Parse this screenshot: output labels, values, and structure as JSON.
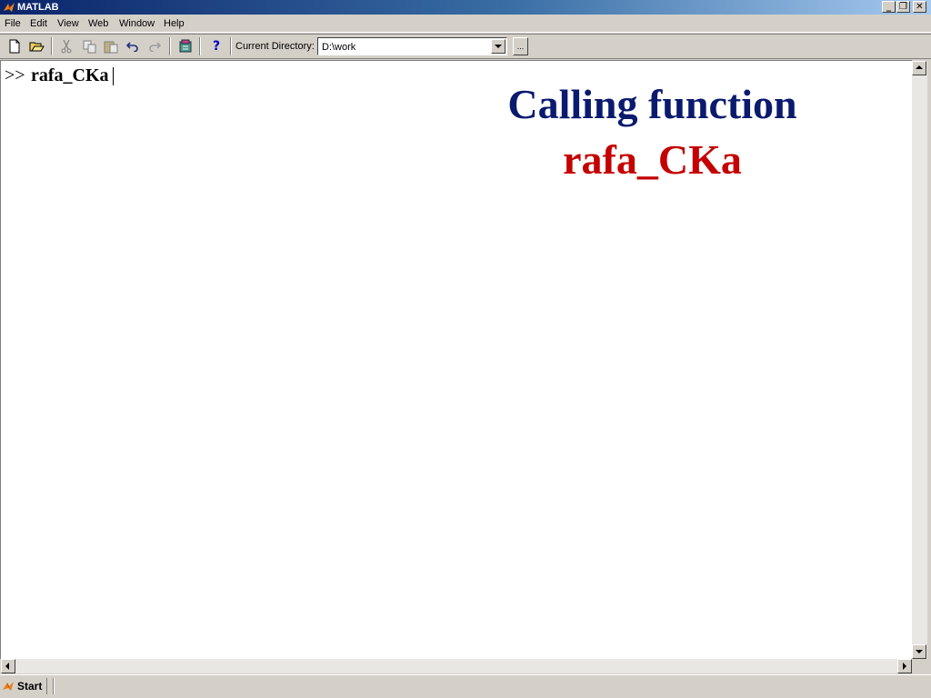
{
  "window": {
    "title": "MATLAB",
    "controls": {
      "minimize": "_",
      "maximize": "❐",
      "close": "✕"
    }
  },
  "menu": [
    "File",
    "Edit",
    "View",
    "Web",
    "Window",
    "Help"
  ],
  "toolbar": {
    "icons": [
      "new-file-icon",
      "open-folder-icon",
      "cut-icon",
      "copy-icon",
      "paste-icon",
      "undo-icon",
      "redo-icon",
      "simulink-icon",
      "help-icon"
    ],
    "help_glyph": "?",
    "current_directory_label": "Current Directory:",
    "current_directory_value": "D:\\work",
    "browse_label": "..."
  },
  "command_window": {
    "prompt": ">>",
    "command": "rafa_CKa"
  },
  "annotation": {
    "line1": "Calling function",
    "line2": "rafa_CKa",
    "line1_color": "#0a1a6e",
    "line2_color": "#c40000"
  },
  "status": {
    "start_label": "Start"
  }
}
